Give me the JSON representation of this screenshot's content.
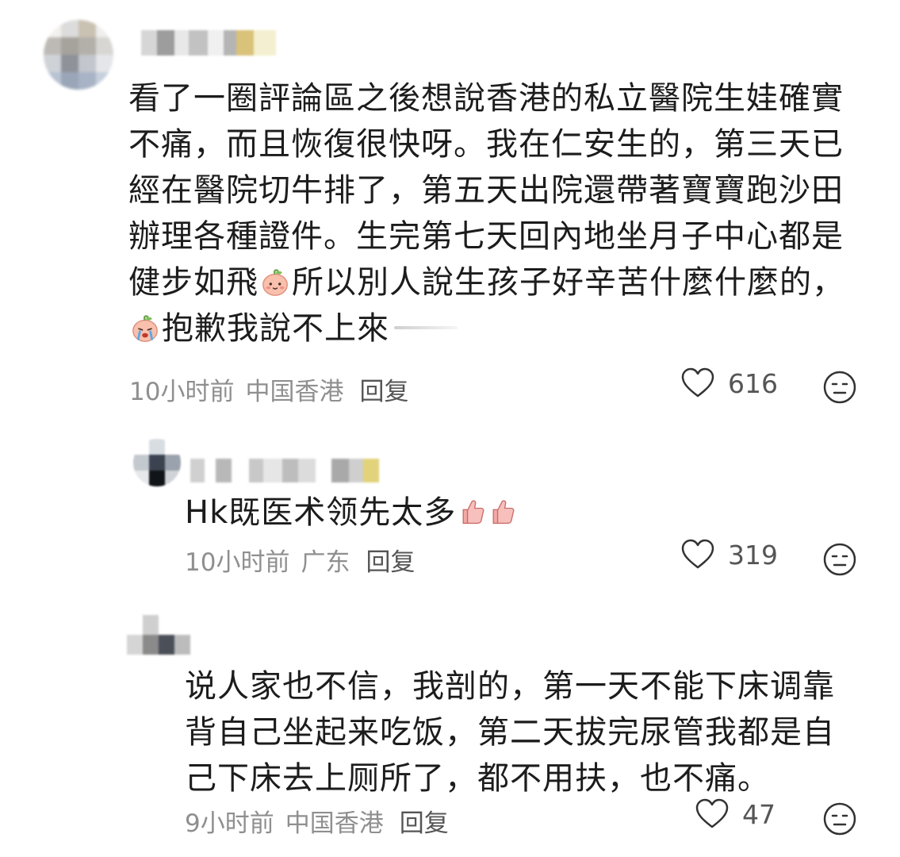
{
  "comments": [
    {
      "text_before_emoji1": "看了一圈評論區之後想說香港的私立醫院生娃確實不痛，而且恢復很快呀。我在仁安生的，第三天已經在醫院切牛排了，第五天出院還帶著寶寶跑沙田辦理各種證件。生完第七天回內地坐月子中心都是健步如飛",
      "text_between_emojis": "所以別人說生孩子好辛苦什麼什麼的，",
      "text_after_emoji2": "抱歉我說不上來",
      "time": "10小时前",
      "location": "中国香港",
      "reply_label": "回复",
      "likes": "616",
      "icons": [
        "heart-icon",
        "dislike-face-icon",
        "peach-smile-emoji",
        "peach-cry-emoji"
      ]
    },
    {
      "text": "Hk既医术领先太多",
      "time": "10小时前",
      "location": "广东",
      "reply_label": "回复",
      "likes": "319",
      "icons": [
        "heart-icon",
        "dislike-face-icon",
        "thumbs-up-emoji"
      ]
    },
    {
      "text": "说人家也不信，我剖的，第一天不能下床调靠背自己坐起来吃饭，第二天拔完尿管我都是自己下床去上厕所了，都不用扶，也不痛。",
      "time": "9小时前",
      "location": "中国香港",
      "reply_label": "回复",
      "likes": "47",
      "icons": [
        "heart-icon",
        "dislike-face-icon"
      ]
    }
  ],
  "colors": {
    "text": "#1c1c1c",
    "meta": "#8f8f8f",
    "reply": "#555555",
    "icon_stroke": "#333333",
    "emoji_peach": "#f6b3a0"
  }
}
